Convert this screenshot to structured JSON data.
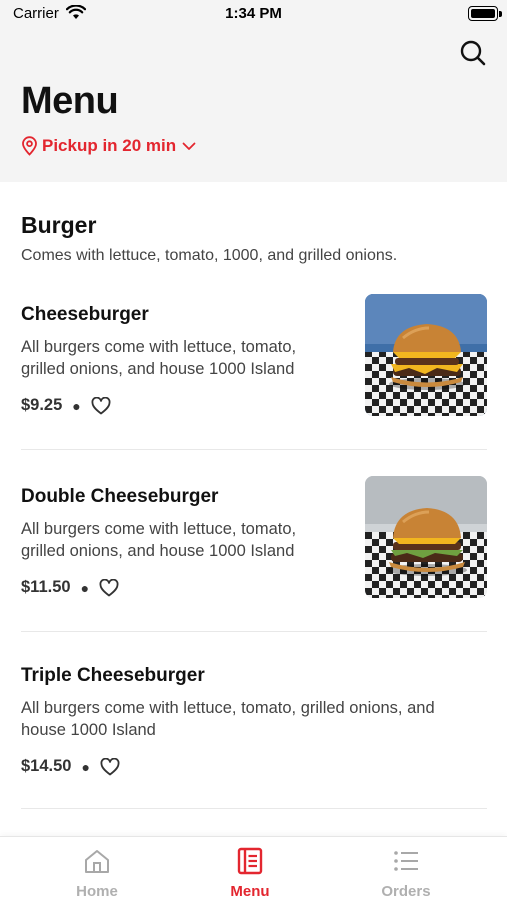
{
  "status_bar": {
    "carrier": "Carrier",
    "time": "1:34 PM"
  },
  "header": {
    "title": "Menu",
    "pickup_label": "Pickup in 20 min",
    "search_icon": "search-icon"
  },
  "colors": {
    "accent": "#e3262f",
    "header_bg": "#f4f4f4",
    "inactive_tab": "#b0b0b0"
  },
  "section": {
    "title": "Burger",
    "description": "Comes with lettuce, tomato, 1000, and grilled onions."
  },
  "items": [
    {
      "name": "Cheeseburger",
      "desc_line1": "All burgers come with lettuce, tomato,",
      "desc_line2": "grilled onions, and house 1000 Island",
      "price": "$9.25",
      "has_image": true
    },
    {
      "name": "Double Cheeseburger",
      "desc_line1": "All burgers come with lettuce, tomato,",
      "desc_line2": "grilled onions, and house 1000 Island",
      "price": "$11.50",
      "has_image": true
    },
    {
      "name": "Triple Cheeseburger",
      "desc_line1": "All burgers come with lettuce, tomato, grilled onions, and",
      "desc_line2": "house 1000 Island",
      "price": "$14.50",
      "has_image": false
    }
  ],
  "tabs": [
    {
      "label": "Home",
      "icon": "home-icon",
      "active": false
    },
    {
      "label": "Menu",
      "icon": "menu-book-icon",
      "active": true
    },
    {
      "label": "Orders",
      "icon": "list-icon",
      "active": false
    }
  ]
}
